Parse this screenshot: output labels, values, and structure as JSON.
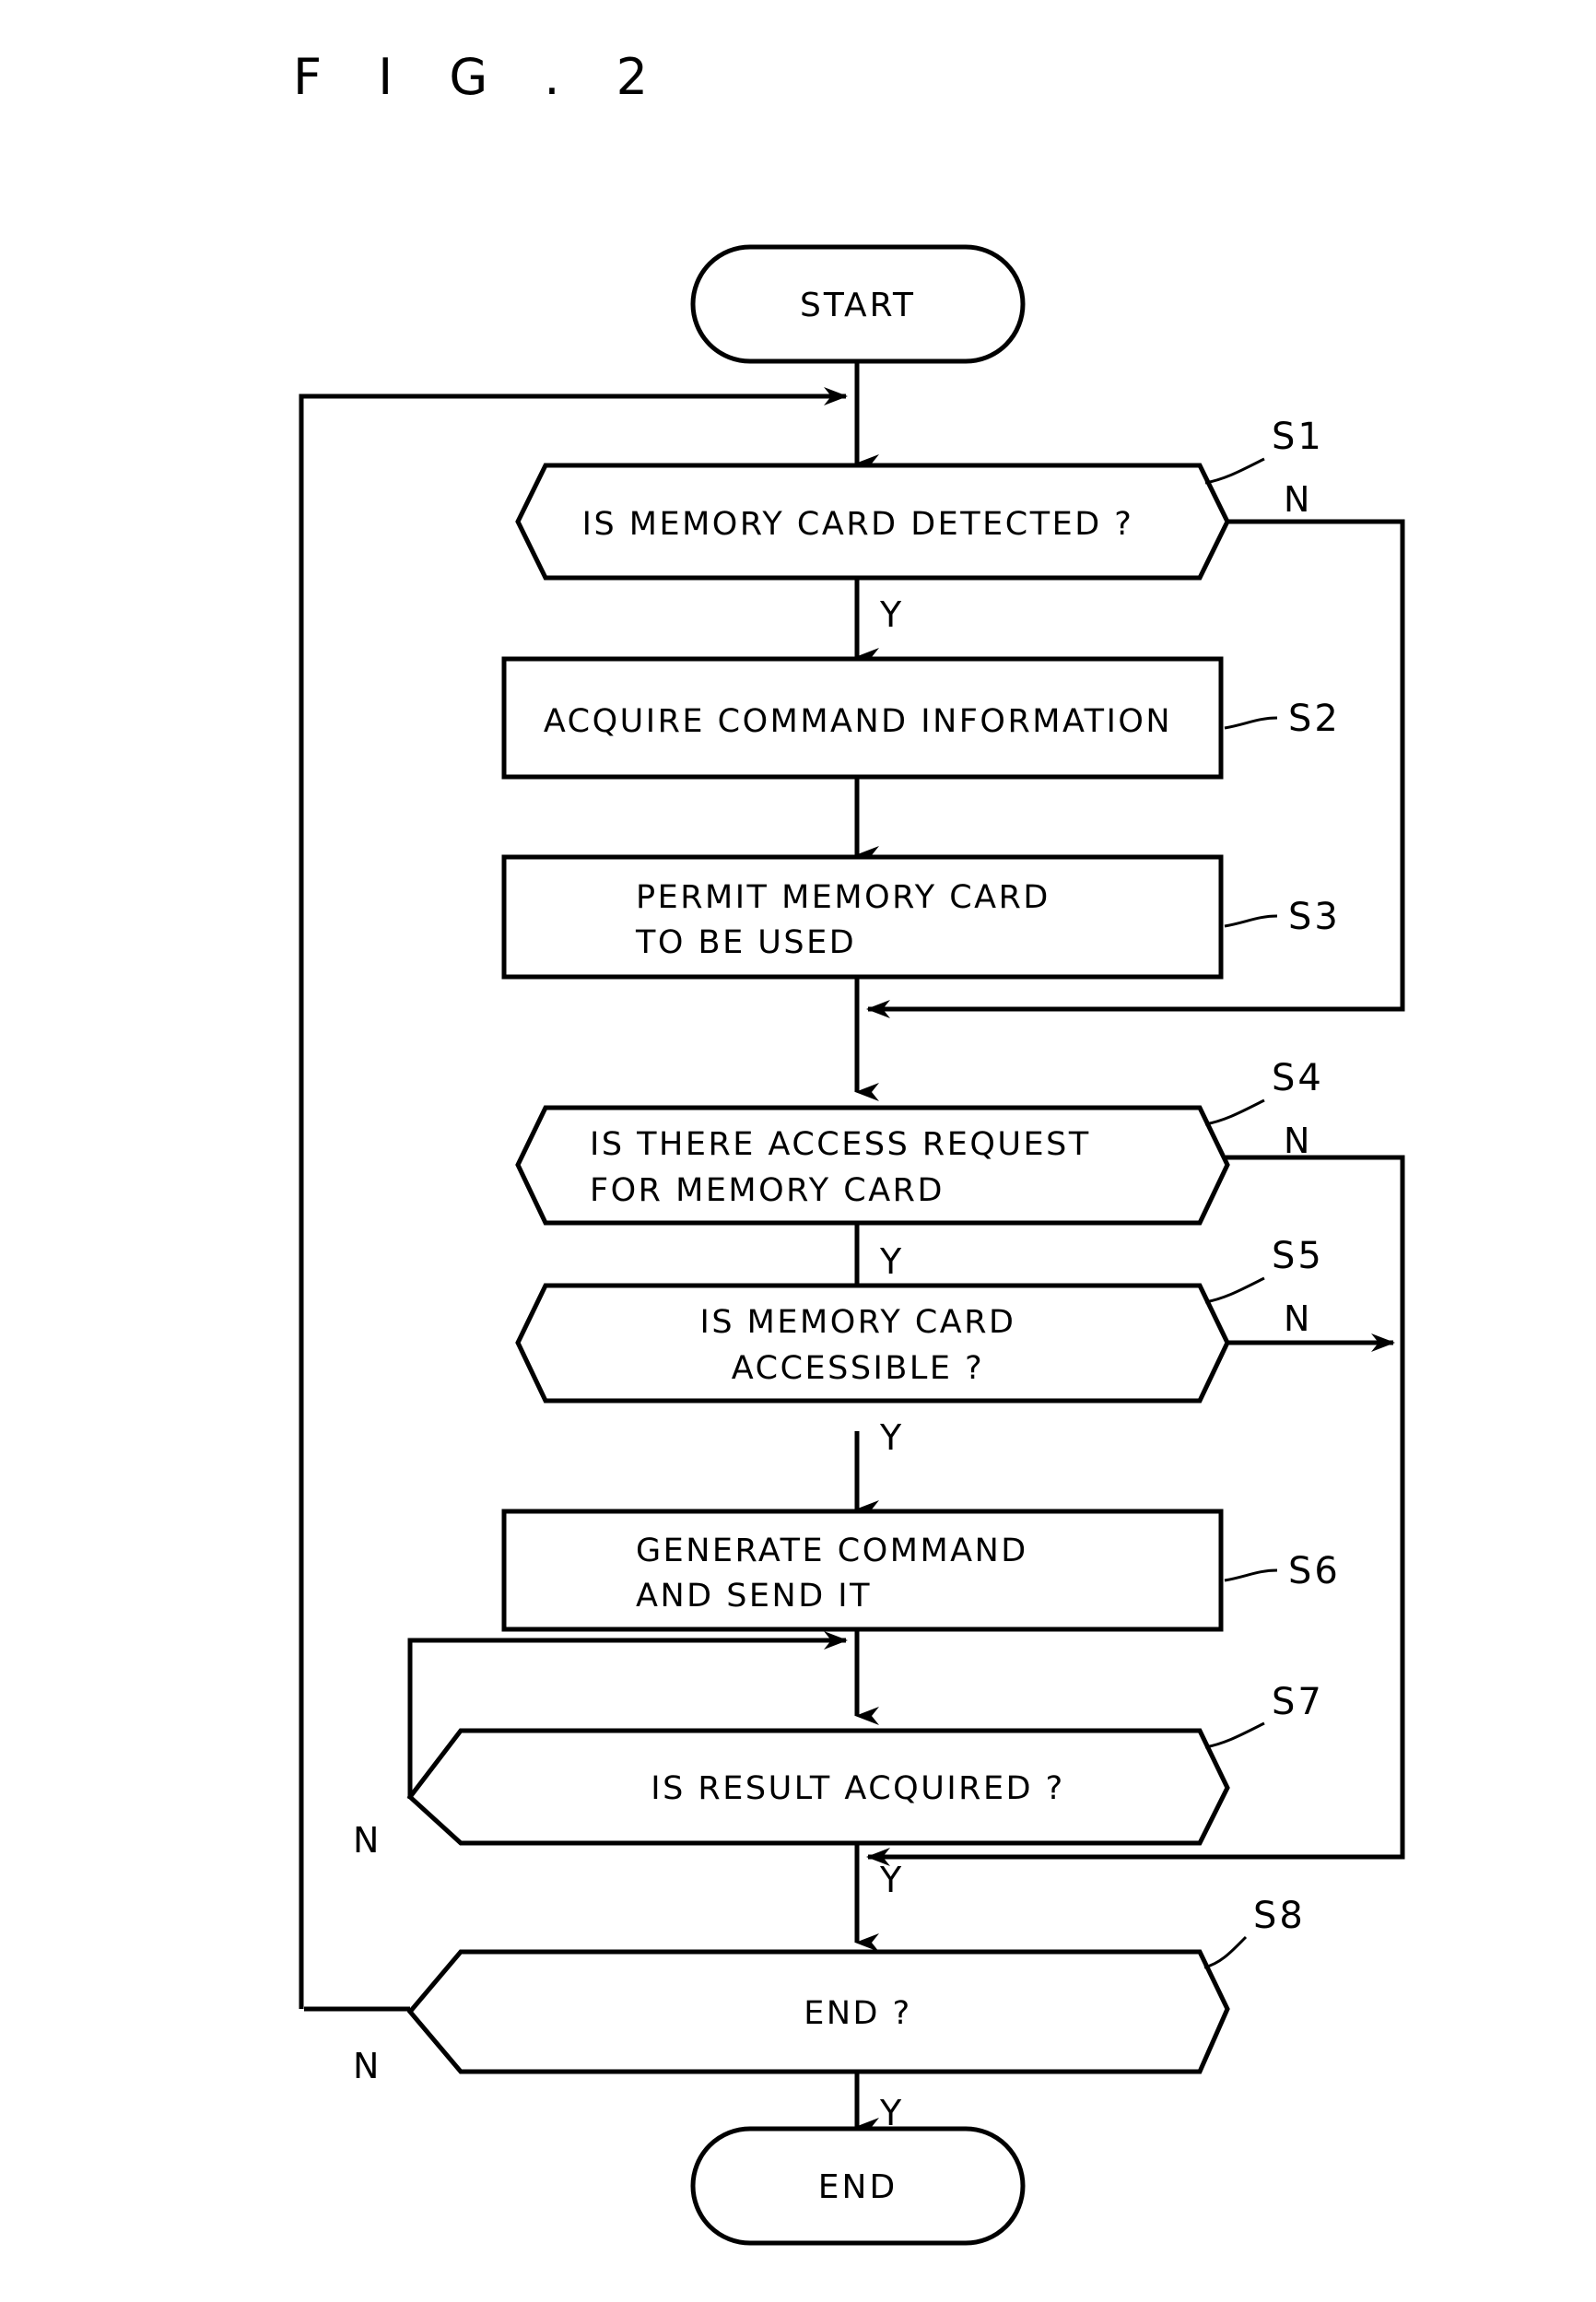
{
  "figure": {
    "title": "F I G . 2"
  },
  "nodes": {
    "start": {
      "label": "START",
      "shape": "terminal"
    },
    "s1": {
      "label": "IS MEMORY CARD DETECTED ?",
      "step": "S1",
      "shape": "decision",
      "yes": "Y",
      "no": "N"
    },
    "s2": {
      "label": "ACQUIRE COMMAND INFORMATION",
      "step": "S2",
      "shape": "process"
    },
    "s3": {
      "line1": "PERMIT MEMORY CARD",
      "line2": "TO BE USED",
      "step": "S3",
      "shape": "process"
    },
    "s4": {
      "line1": "IS THERE ACCESS REQUEST",
      "line2": "FOR MEMORY CARD",
      "step": "S4",
      "shape": "decision",
      "yes": "Y",
      "no": "N"
    },
    "s5": {
      "line1": "IS MEMORY CARD",
      "line2": "ACCESSIBLE ?",
      "step": "S5",
      "shape": "decision",
      "yes": "Y",
      "no": "N"
    },
    "s6": {
      "line1": "GENERATE COMMAND",
      "line2": "AND SEND IT",
      "step": "S6",
      "shape": "process"
    },
    "s7": {
      "label": "IS RESULT ACQUIRED ?",
      "step": "S7",
      "shape": "decision",
      "yes": "Y",
      "no": "N"
    },
    "s8": {
      "label": "END ?",
      "step": "S8",
      "shape": "decision",
      "yes": "Y",
      "no": "N"
    },
    "end": {
      "label": "END",
      "shape": "terminal"
    }
  },
  "colors": {
    "stroke": "#000000",
    "fill": "#ffffff",
    "background": "#ffffff"
  }
}
